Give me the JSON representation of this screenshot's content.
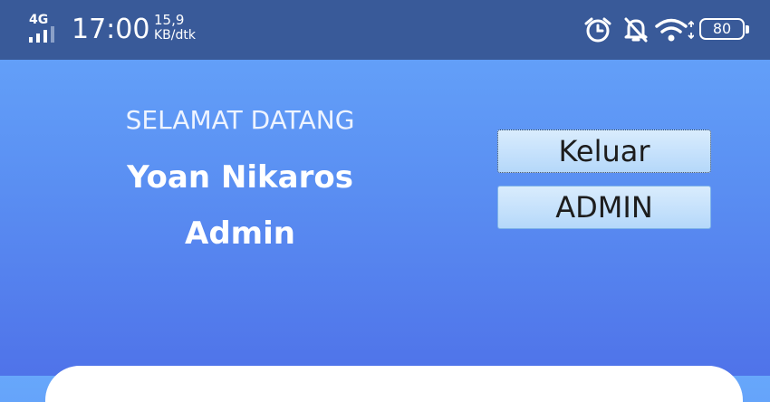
{
  "status_bar": {
    "network_type": "4G",
    "time": "17:00",
    "speed_value": "15,9",
    "speed_unit": "KB/dtk",
    "battery_level": "80"
  },
  "welcome": {
    "greeting": "SELAMAT DATANG",
    "user_name": "Yoan Nikaros",
    "user_role": "Admin"
  },
  "actions": {
    "logout_label": "Keluar",
    "admin_label": "ADMIN"
  },
  "colors": {
    "status_bar_bg": "#395a99",
    "background_top": "#67a7fb",
    "background_bottom": "#4f73e9",
    "button_bg": "#c6e2fb"
  }
}
